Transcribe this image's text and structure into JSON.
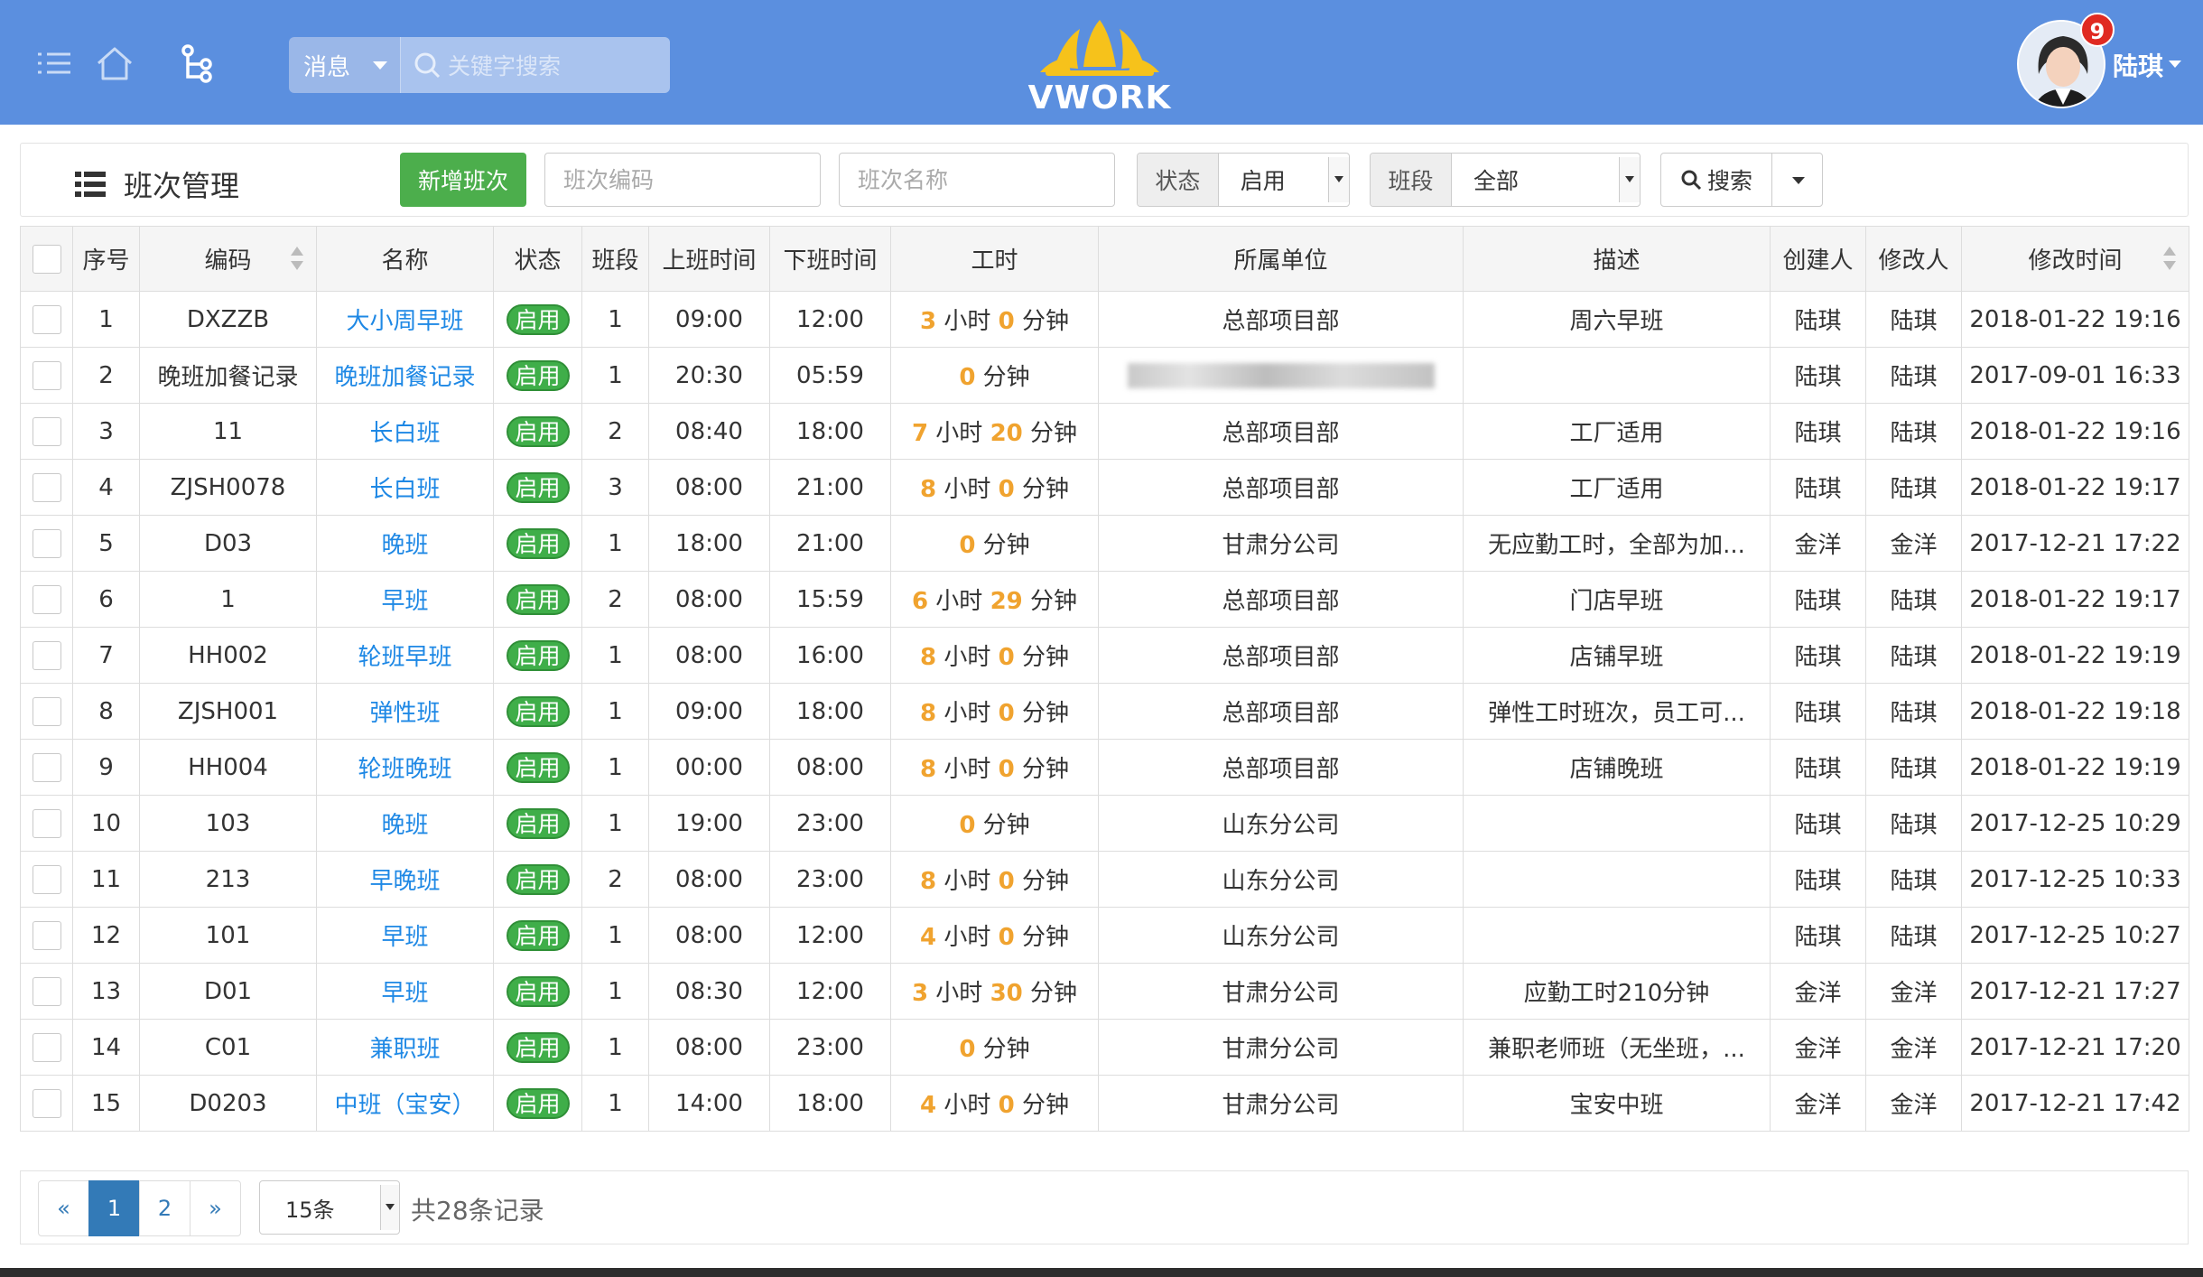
{
  "header": {
    "search_type": "消息",
    "search_placeholder": "关键字搜索",
    "logo_text": "VWORK",
    "notification_count": "9",
    "user_name": "陆琪"
  },
  "toolbar": {
    "title": "班次管理",
    "add_label": "新增班次",
    "code_placeholder": "班次编码",
    "name_placeholder": "班次名称",
    "status_label": "状态",
    "status_value": "启用",
    "segment_label": "班段",
    "segment_value": "全部",
    "search_label": "搜索"
  },
  "table": {
    "columns": [
      "序号",
      "编码",
      "名称",
      "状态",
      "班段",
      "上班时间",
      "下班时间",
      "工时",
      "所属单位",
      "描述",
      "创建人",
      "修改人",
      "修改时间"
    ],
    "rows": [
      {
        "no": "1",
        "code": "DXZZB",
        "name": "大小周早班",
        "status": "启用",
        "seg": "1",
        "start": "09:00",
        "end": "12:00",
        "h": "3",
        "hu": "小时",
        "m": "0",
        "mu": "分钟",
        "unit": "总部项目部",
        "desc": "周六早班",
        "creator": "陆琪",
        "modifier": "陆琪",
        "time": "2018-01-22 19:16"
      },
      {
        "no": "2",
        "code": "晚班加餐记录",
        "name": "晚班加餐记录",
        "status": "启用",
        "seg": "1",
        "start": "20:30",
        "end": "05:59",
        "h": "",
        "hu": "",
        "m": "0",
        "mu": "分钟",
        "unit": "",
        "desc": "",
        "creator": "陆琪",
        "modifier": "陆琪",
        "time": "2017-09-01 16:33"
      },
      {
        "no": "3",
        "code": "11",
        "name": "长白班",
        "status": "启用",
        "seg": "2",
        "start": "08:40",
        "end": "18:00",
        "h": "7",
        "hu": "小时",
        "m": "20",
        "mu": "分钟",
        "unit": "总部项目部",
        "desc": "工厂适用",
        "creator": "陆琪",
        "modifier": "陆琪",
        "time": "2018-01-22 19:16"
      },
      {
        "no": "4",
        "code": "ZJSH0078",
        "name": "长白班",
        "status": "启用",
        "seg": "3",
        "start": "08:00",
        "end": "21:00",
        "h": "8",
        "hu": "小时",
        "m": "0",
        "mu": "分钟",
        "unit": "总部项目部",
        "desc": "工厂适用",
        "creator": "陆琪",
        "modifier": "陆琪",
        "time": "2018-01-22 19:17"
      },
      {
        "no": "5",
        "code": "D03",
        "name": "晚班",
        "status": "启用",
        "seg": "1",
        "start": "18:00",
        "end": "21:00",
        "h": "",
        "hu": "",
        "m": "0",
        "mu": "分钟",
        "unit": "甘肃分公司",
        "desc": "无应勤工时，全部为加...",
        "creator": "金洋",
        "modifier": "金洋",
        "time": "2017-12-21 17:22"
      },
      {
        "no": "6",
        "code": "1",
        "name": "早班",
        "status": "启用",
        "seg": "2",
        "start": "08:00",
        "end": "15:59",
        "h": "6",
        "hu": "小时",
        "m": "29",
        "mu": "分钟",
        "unit": "总部项目部",
        "desc": "门店早班",
        "creator": "陆琪",
        "modifier": "陆琪",
        "time": "2018-01-22 19:17"
      },
      {
        "no": "7",
        "code": "HH002",
        "name": "轮班早班",
        "status": "启用",
        "seg": "1",
        "start": "08:00",
        "end": "16:00",
        "h": "8",
        "hu": "小时",
        "m": "0",
        "mu": "分钟",
        "unit": "总部项目部",
        "desc": "店铺早班",
        "creator": "陆琪",
        "modifier": "陆琪",
        "time": "2018-01-22 19:19"
      },
      {
        "no": "8",
        "code": "ZJSH001",
        "name": "弹性班",
        "status": "启用",
        "seg": "1",
        "start": "09:00",
        "end": "18:00",
        "h": "8",
        "hu": "小时",
        "m": "0",
        "mu": "分钟",
        "unit": "总部项目部",
        "desc": "弹性工时班次，员工可...",
        "creator": "陆琪",
        "modifier": "陆琪",
        "time": "2018-01-22 19:18"
      },
      {
        "no": "9",
        "code": "HH004",
        "name": "轮班晚班",
        "status": "启用",
        "seg": "1",
        "start": "00:00",
        "end": "08:00",
        "h": "8",
        "hu": "小时",
        "m": "0",
        "mu": "分钟",
        "unit": "总部项目部",
        "desc": "店铺晚班",
        "creator": "陆琪",
        "modifier": "陆琪",
        "time": "2018-01-22 19:19"
      },
      {
        "no": "10",
        "code": "103",
        "name": "晚班",
        "status": "启用",
        "seg": "1",
        "start": "19:00",
        "end": "23:00",
        "h": "",
        "hu": "",
        "m": "0",
        "mu": "分钟",
        "unit": "山东分公司",
        "desc": "",
        "creator": "陆琪",
        "modifier": "陆琪",
        "time": "2017-12-25 10:29"
      },
      {
        "no": "11",
        "code": "213",
        "name": "早晚班",
        "status": "启用",
        "seg": "2",
        "start": "08:00",
        "end": "23:00",
        "h": "8",
        "hu": "小时",
        "m": "0",
        "mu": "分钟",
        "unit": "山东分公司",
        "desc": "",
        "creator": "陆琪",
        "modifier": "陆琪",
        "time": "2017-12-25 10:33"
      },
      {
        "no": "12",
        "code": "101",
        "name": "早班",
        "status": "启用",
        "seg": "1",
        "start": "08:00",
        "end": "12:00",
        "h": "4",
        "hu": "小时",
        "m": "0",
        "mu": "分钟",
        "unit": "山东分公司",
        "desc": "",
        "creator": "陆琪",
        "modifier": "陆琪",
        "time": "2017-12-25 10:27"
      },
      {
        "no": "13",
        "code": "D01",
        "name": "早班",
        "status": "启用",
        "seg": "1",
        "start": "08:30",
        "end": "12:00",
        "h": "3",
        "hu": "小时",
        "m": "30",
        "mu": "分钟",
        "unit": "甘肃分公司",
        "desc": "应勤工时210分钟",
        "creator": "金洋",
        "modifier": "金洋",
        "time": "2017-12-21 17:27"
      },
      {
        "no": "14",
        "code": "C01",
        "name": "兼职班",
        "status": "启用",
        "seg": "1",
        "start": "08:00",
        "end": "23:00",
        "h": "",
        "hu": "",
        "m": "0",
        "mu": "分钟",
        "unit": "甘肃分公司",
        "desc": "兼职老师班（无坐班，...",
        "creator": "金洋",
        "modifier": "金洋",
        "time": "2017-12-21 17:20"
      },
      {
        "no": "15",
        "code": "D0203",
        "name": "中班（宝安）",
        "status": "启用",
        "seg": "1",
        "start": "14:00",
        "end": "18:00",
        "h": "4",
        "hu": "小时",
        "m": "0",
        "mu": "分钟",
        "unit": "甘肃分公司",
        "desc": "宝安中班",
        "creator": "金洋",
        "modifier": "金洋",
        "time": "2017-12-21 17:42"
      }
    ]
  },
  "pagination": {
    "prev": "«",
    "pages": [
      "1",
      "2"
    ],
    "next": "»",
    "page_size": "15条",
    "total": "共28条记录"
  },
  "colors": {
    "header_bg": "#5b8fdf",
    "add_button": "#4cae4c",
    "status_pill": "#3fae49",
    "link": "#1e88e5",
    "hour_number": "#f0a32f",
    "active_page": "#337ab7"
  }
}
